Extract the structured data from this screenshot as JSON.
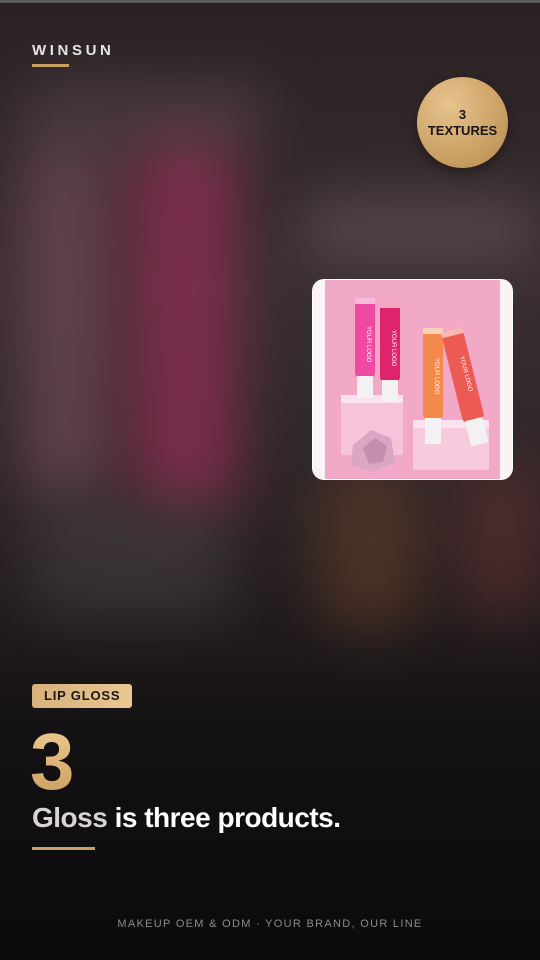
{
  "brand": {
    "name": "WINSUN"
  },
  "badge": {
    "line1": "3",
    "line2": "TEXTURES"
  },
  "photo": {
    "tube_text": "YOUR LOGO"
  },
  "tag": {
    "label": "LIP GLOSS"
  },
  "step_number": "3",
  "headline": {
    "accent": "Gloss",
    "rest": " is three products."
  },
  "footer": {
    "text": "MAKEUP OEM & ODM · YOUR BRAND, OUR LINE"
  },
  "colors": {
    "accent_gold": "#c9a064",
    "background": "#1a1618",
    "photo_bg": "#f2a9c8"
  },
  "icons": {
    "photo": "lip-gloss-product-photo"
  }
}
